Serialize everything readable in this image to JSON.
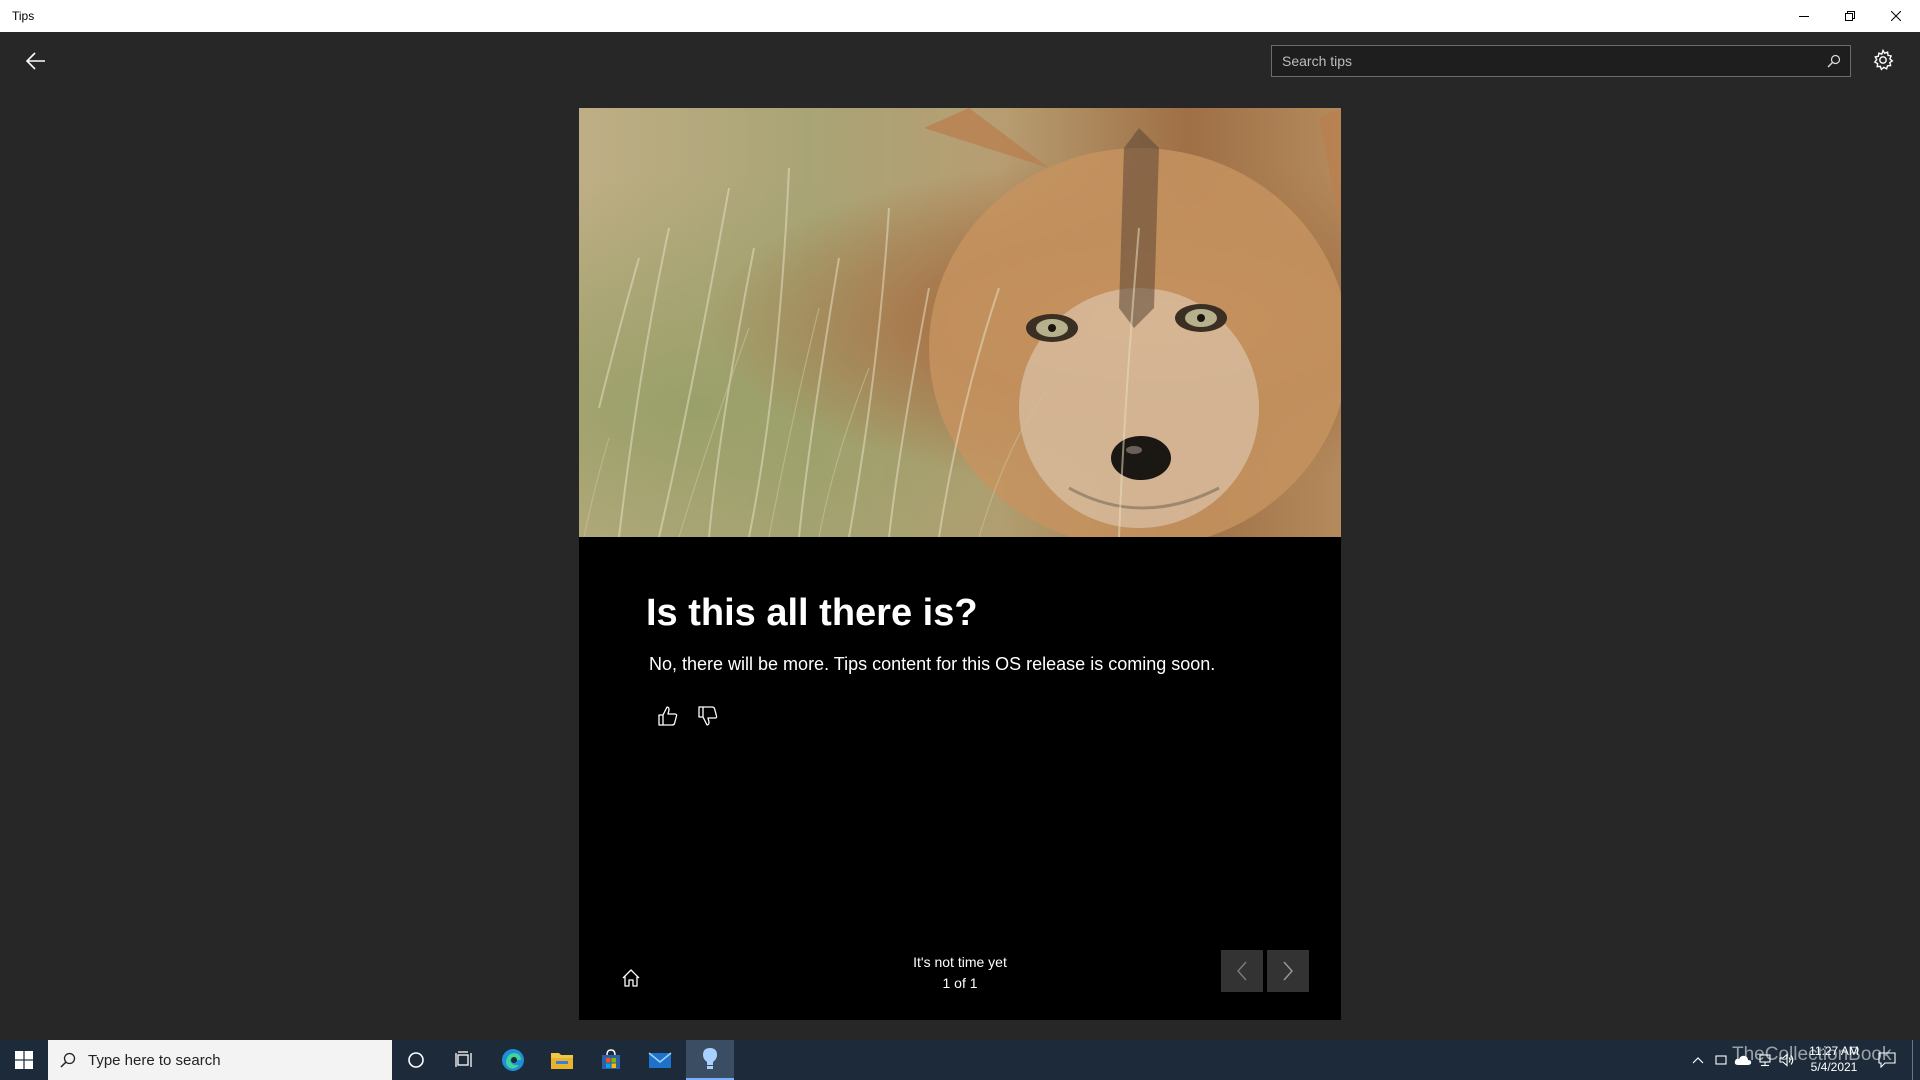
{
  "window": {
    "title": "Tips"
  },
  "search": {
    "placeholder": "Search tips"
  },
  "tip": {
    "title": "Is this all there is?",
    "body": "No, there will be more. Tips content for this OS release is coming soon.",
    "collection_name": "It's not time yet",
    "position": "1 of 1"
  },
  "taskbar": {
    "search_placeholder": "Type here to search",
    "time": "11:27 AM",
    "date": "5/4/2021",
    "watermark": "TheCollectionBook"
  },
  "colors": {
    "app_background": "#272727",
    "card_background": "#000000",
    "taskbar_background": "#1c2a3a",
    "accent": "#77b1ff"
  },
  "icons": [
    "back-arrow-icon",
    "search-icon",
    "gear-icon",
    "thumbs-up-icon",
    "thumbs-down-icon",
    "home-icon",
    "chevron-left-icon",
    "chevron-right-icon",
    "windows-logo-icon",
    "cortana-icon",
    "task-view-icon",
    "edge-icon",
    "file-explorer-icon",
    "store-icon",
    "mail-icon",
    "tips-icon"
  ]
}
